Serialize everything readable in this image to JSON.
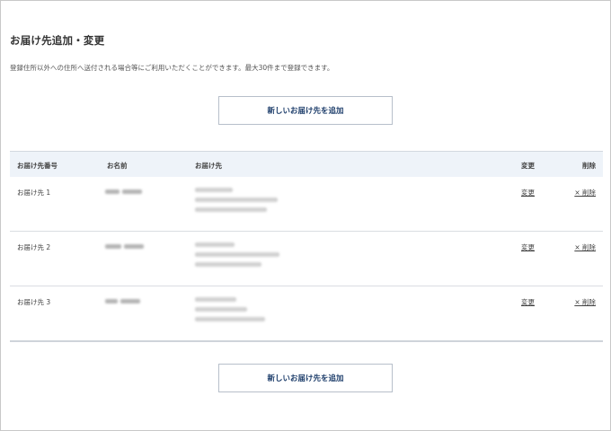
{
  "page": {
    "title": "お届け先追加・変更",
    "description": "登録住所以外への住所へ送付される場合等にご利用いただくことができます。最大30件まで登録できます。",
    "add_button_label": "新しいお届け先を追加"
  },
  "table": {
    "headers": {
      "number": "お届け先番号",
      "name": "お名前",
      "address": "お届け先",
      "edit": "変更",
      "delete": "削除"
    },
    "rows": [
      {
        "number": "お届け先 1",
        "edit_label": "変更",
        "delete_label": "× 削除"
      },
      {
        "number": "お届け先 2",
        "edit_label": "変更",
        "delete_label": "× 削除"
      },
      {
        "number": "お届け先 3",
        "edit_label": "変更",
        "delete_label": "× 削除"
      }
    ]
  },
  "colors": {
    "header_bg": "#eef3f9",
    "link": "#2d64a8",
    "button_text": "#1f3f6c",
    "button_border": "#b7bfca"
  }
}
